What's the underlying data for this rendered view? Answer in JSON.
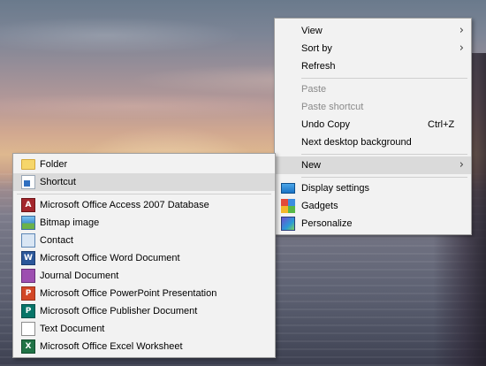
{
  "main_menu": {
    "view": "View",
    "sort_by": "Sort by",
    "refresh": "Refresh",
    "paste": "Paste",
    "paste_shortcut": "Paste shortcut",
    "undo_copy": "Undo Copy",
    "undo_shortcut": "Ctrl+Z",
    "next_background": "Next desktop background",
    "new": "New",
    "display_settings": "Display settings",
    "gadgets": "Gadgets",
    "personalize": "Personalize",
    "submenu_arrow": "›"
  },
  "new_submenu": {
    "folder": "Folder",
    "shortcut": "Shortcut",
    "items": [
      {
        "label": "Microsoft Office Access 2007 Database",
        "icon": "access-icon"
      },
      {
        "label": "Bitmap image",
        "icon": "bitmap-icon"
      },
      {
        "label": "Contact",
        "icon": "contact-icon"
      },
      {
        "label": "Microsoft Office Word Document",
        "icon": "word-icon"
      },
      {
        "label": "Journal Document",
        "icon": "journal-icon"
      },
      {
        "label": "Microsoft Office PowerPoint Presentation",
        "icon": "powerpoint-icon"
      },
      {
        "label": "Microsoft Office Publisher Document",
        "icon": "publisher-icon"
      },
      {
        "label": "Text Document",
        "icon": "text-document-icon"
      },
      {
        "label": "Microsoft Office Excel Worksheet",
        "icon": "excel-icon"
      }
    ]
  },
  "state": {
    "highlighted_main_item": "New",
    "highlighted_submenu_item": "Shortcut",
    "disabled_items": [
      "Paste",
      "Paste shortcut"
    ]
  },
  "colors": {
    "menu_bg": "#f2f2f2",
    "highlight_bg": "#dadada",
    "disabled_text": "#8a8a8a"
  }
}
